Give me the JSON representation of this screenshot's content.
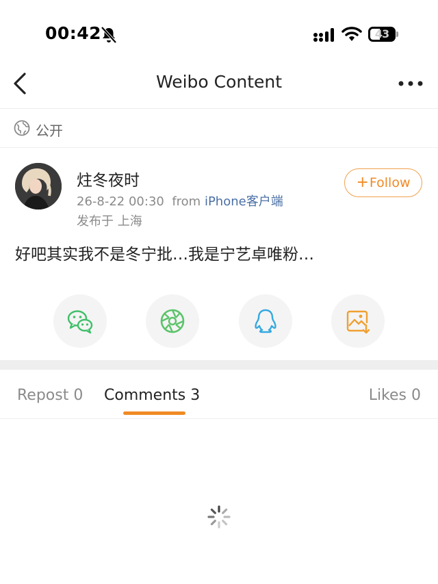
{
  "status_bar": {
    "time": "00:42",
    "battery": "43"
  },
  "nav": {
    "title": "Weibo Content"
  },
  "post": {
    "visibility": "公开",
    "author": "炷冬夜时",
    "date": "26-8-22 00:30",
    "source_prefix": "from",
    "source": "iPhone客户端",
    "location": "发布于 上海",
    "follow_label": "Follow",
    "text": "好吧其实我不是冬宁批…我是宁艺卓唯粉…"
  },
  "share": {
    "icons": [
      "wechat-icon",
      "moments-icon",
      "qq-icon",
      "save-image-icon"
    ],
    "colors": {
      "wechat": "#3fbf6a",
      "moments": "#5cc36a",
      "qq": "#35a9e0",
      "save": "#f0a030"
    }
  },
  "tabs": {
    "repost": "Repost 0",
    "comments": "Comments 3",
    "likes": "Likes 0",
    "active": "comments"
  },
  "colors": {
    "accent": "#f08a24",
    "link": "#4a6fa5",
    "muted": "#8a8a8a"
  }
}
